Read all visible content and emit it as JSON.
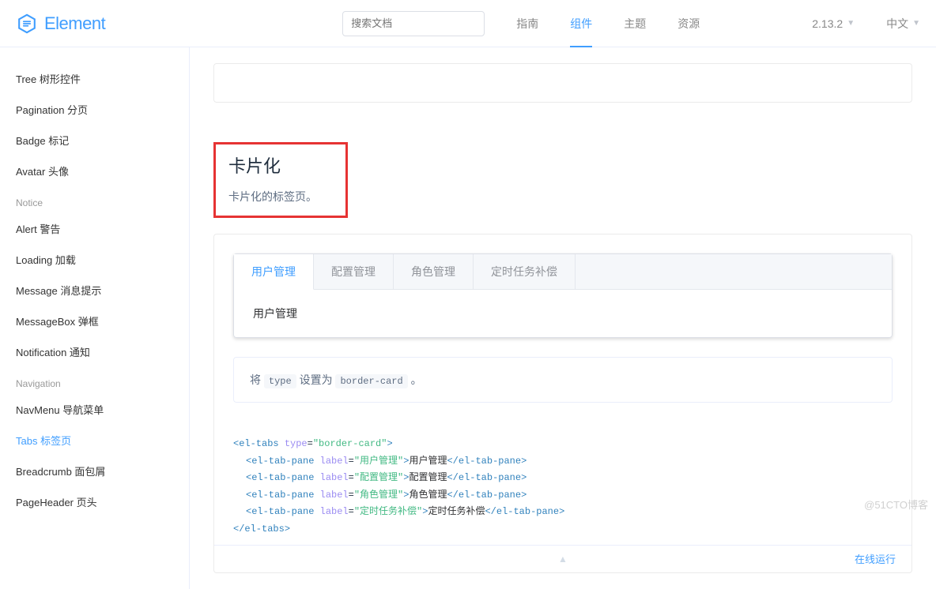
{
  "header": {
    "logo_text": "Element",
    "search_placeholder": "搜索文档",
    "nav": {
      "guide": "指南",
      "component": "组件",
      "theme": "主题",
      "resource": "资源"
    },
    "version": "2.13.2",
    "language": "中文"
  },
  "sidebar": {
    "items1": [
      "Tree 树形控件",
      "Pagination 分页",
      "Badge 标记",
      "Avatar 头像"
    ],
    "group1": "Notice",
    "items2": [
      "Alert 警告",
      "Loading 加载",
      "Message 消息提示",
      "MessageBox 弹框",
      "Notification 通知"
    ],
    "group2": "Navigation",
    "items3": [
      "NavMenu 导航菜单",
      "Tabs 标签页",
      "Breadcrumb 面包屑",
      "PageHeader 页头"
    ],
    "active": "Tabs 标签页"
  },
  "section": {
    "title": "卡片化",
    "desc": "卡片化的标签页。"
  },
  "demo": {
    "tabs": [
      "用户管理",
      "配置管理",
      "角色管理",
      "定时任务补偿"
    ],
    "active_content": "用户管理"
  },
  "hint": {
    "pre": "将 ",
    "code1": "type",
    "mid": " 设置为 ",
    "code2": "border-card",
    "post": " 。"
  },
  "code": {
    "open_tag": "el-tabs",
    "type_attr": "type",
    "type_val": "\"border-card\"",
    "pane_tag": "el-tab-pane",
    "label_attr": "label",
    "panes": [
      {
        "label": "\"用户管理\"",
        "text": "用户管理"
      },
      {
        "label": "\"配置管理\"",
        "text": "配置管理"
      },
      {
        "label": "\"角色管理\"",
        "text": "角色管理"
      },
      {
        "label": "\"定时任务补偿\"",
        "text": "定时任务补偿"
      }
    ]
  },
  "footer": {
    "run": "在线运行"
  },
  "watermark": "@51CTO博客"
}
